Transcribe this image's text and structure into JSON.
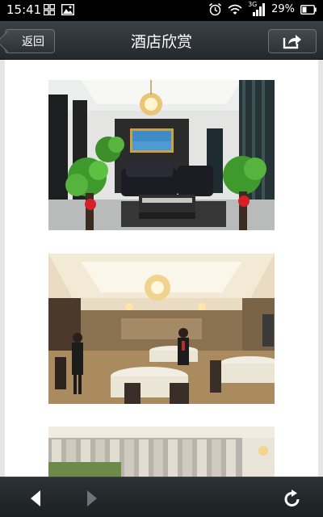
{
  "status_bar": {
    "time": "15:41",
    "network": "3G",
    "battery": "29%"
  },
  "header": {
    "back_label": "返回",
    "title": "酒店欣赏"
  },
  "gallery": {
    "photos": [
      {
        "subject": "lobby-lounge"
      },
      {
        "subject": "dining-hall"
      },
      {
        "subject": "window-hall"
      }
    ]
  },
  "icons": {
    "back": "arrow-left-icon",
    "forward": "arrow-right-icon",
    "refresh": "refresh-icon",
    "share": "share-icon"
  },
  "colors": {
    "header_bg": "#2f3639",
    "content_bg": "#ffffff",
    "status_bg": "#000000"
  }
}
